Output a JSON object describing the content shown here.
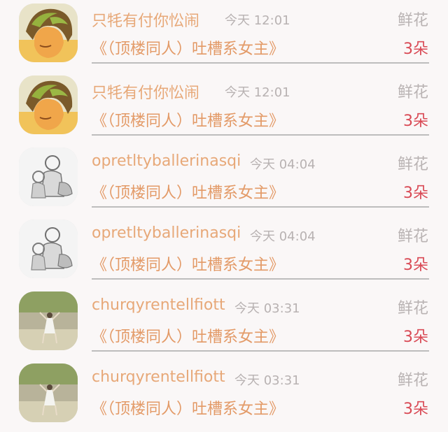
{
  "rows": [
    {
      "avatar": "avatar-anime-boy",
      "username": "只牦有付你忪闹",
      "time": "今天 12:01",
      "gift_type": "鲜花",
      "book_title": "《（顶楼同人）吐槽系女主》",
      "count": "3朵"
    },
    {
      "avatar": "avatar-anime-boy",
      "username": "只牦有付你忪闹",
      "time": "今天 12:01",
      "gift_type": "鲜花",
      "book_title": "《（顶楼同人）吐槽系女主》",
      "count": "3朵"
    },
    {
      "avatar": "avatar-sketch-mother",
      "username": "opretltyballerinasqi",
      "time": "今天 04:04",
      "gift_type": "鲜花",
      "book_title": "《（顶楼同人）吐槽系女主》",
      "count": "3朵"
    },
    {
      "avatar": "avatar-sketch-mother",
      "username": "opretltyballerinasqi",
      "time": "今天 04:04",
      "gift_type": "鲜花",
      "book_title": "《（顶楼同人）吐槽系女主》",
      "count": "3朵"
    },
    {
      "avatar": "avatar-photo-girl",
      "username": "churqyrentellfiott",
      "time": "今天 03:31",
      "gift_type": "鲜花",
      "book_title": "《（顶楼同人）吐槽系女主》",
      "count": "3朵"
    },
    {
      "avatar": "avatar-photo-girl",
      "username": "churqyrentellfiott",
      "time": "今天 03:31",
      "gift_type": "鲜花",
      "book_title": "《（顶楼同人）吐槽系女主》",
      "count": "3朵"
    }
  ]
}
